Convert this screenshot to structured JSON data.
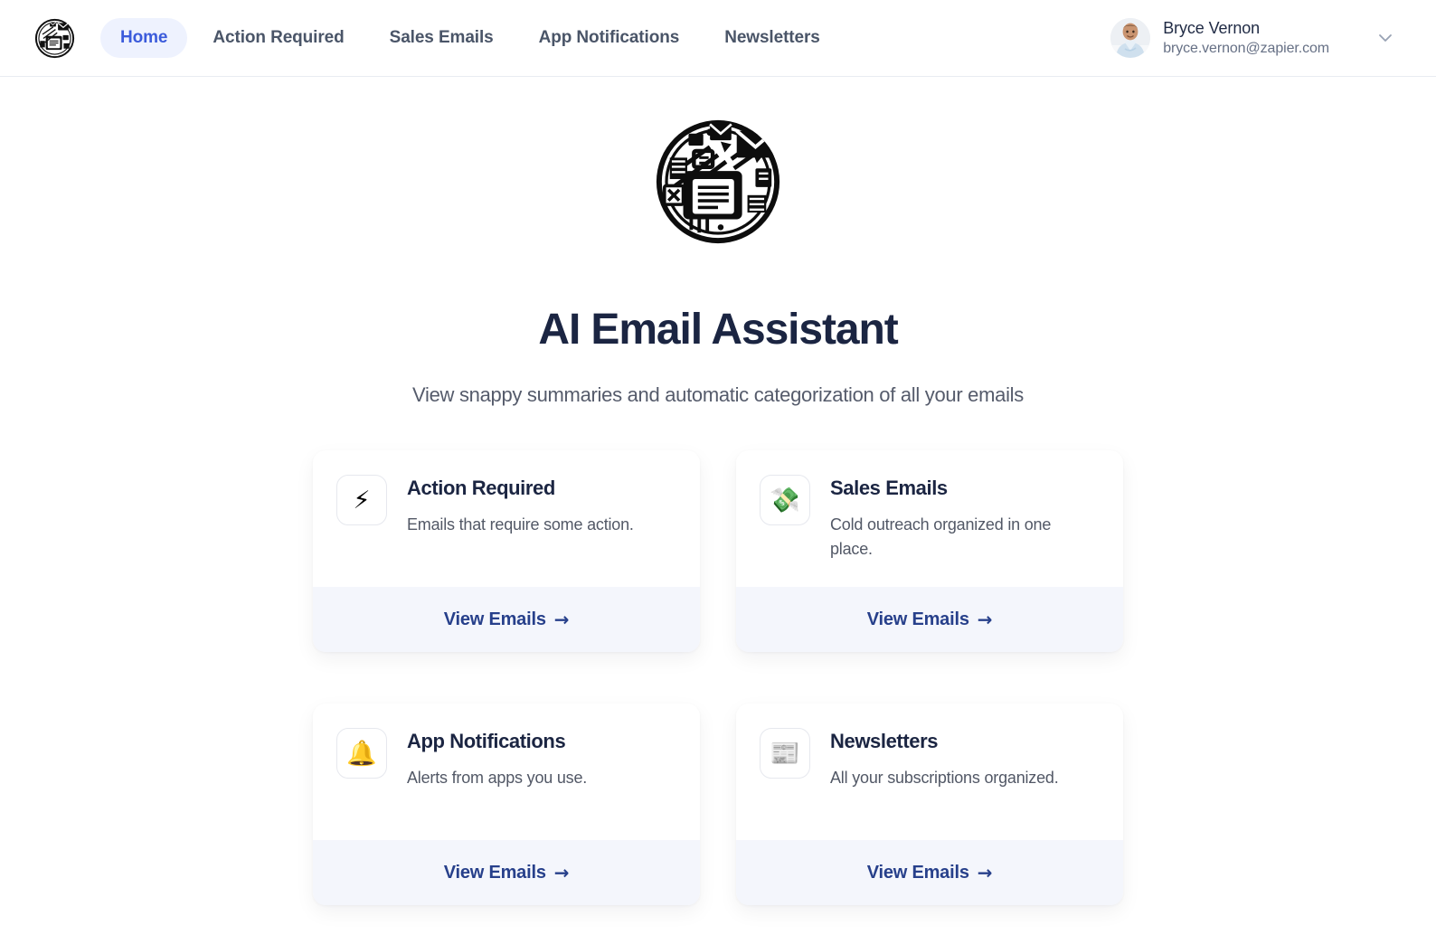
{
  "app": {
    "logo_icon": "email-assistant-logo-icon"
  },
  "nav": {
    "items": [
      {
        "label": "Home",
        "active": true
      },
      {
        "label": "Action Required",
        "active": false
      },
      {
        "label": "Sales Emails",
        "active": false
      },
      {
        "label": "App Notifications",
        "active": false
      },
      {
        "label": "Newsletters",
        "active": false
      }
    ]
  },
  "user": {
    "name": "Bryce Vernon",
    "email": "bryce.vernon@zapier.com",
    "avatar_icon": "user-avatar-photo",
    "chevron_icon": "chevron-down-icon"
  },
  "hero": {
    "logo_icon": "email-assistant-logo-icon",
    "title": "AI Email Assistant",
    "subtitle": "View snappy summaries and automatic categorization of all your emails"
  },
  "cards": [
    {
      "emoji": "⚡",
      "emoji_name": "high-voltage-icon",
      "title": "Action Required",
      "description": "Emails that require some action.",
      "link_label": "View Emails",
      "link_arrow": "→"
    },
    {
      "emoji": "💸",
      "emoji_name": "money-with-wings-icon",
      "title": "Sales Emails",
      "description": "Cold outreach organized in one place.",
      "link_label": "View Emails",
      "link_arrow": "→"
    },
    {
      "emoji": "🔔",
      "emoji_name": "bell-icon",
      "title": "App Notifications",
      "description": "Alerts from apps you use.",
      "link_label": "View Emails",
      "link_arrow": "→"
    },
    {
      "emoji": "📰",
      "emoji_name": "newspaper-icon",
      "title": "Newsletters",
      "description": "All your subscriptions organized.",
      "link_label": "View Emails",
      "link_arrow": "→"
    }
  ],
  "colors": {
    "accent_blue": "#3b5bdb",
    "active_pill_bg": "#eef2fe",
    "title_navy": "#1b2542",
    "link_navy": "#27408b",
    "footer_bg": "#f4f6fc",
    "nav_text": "#4a5568"
  }
}
